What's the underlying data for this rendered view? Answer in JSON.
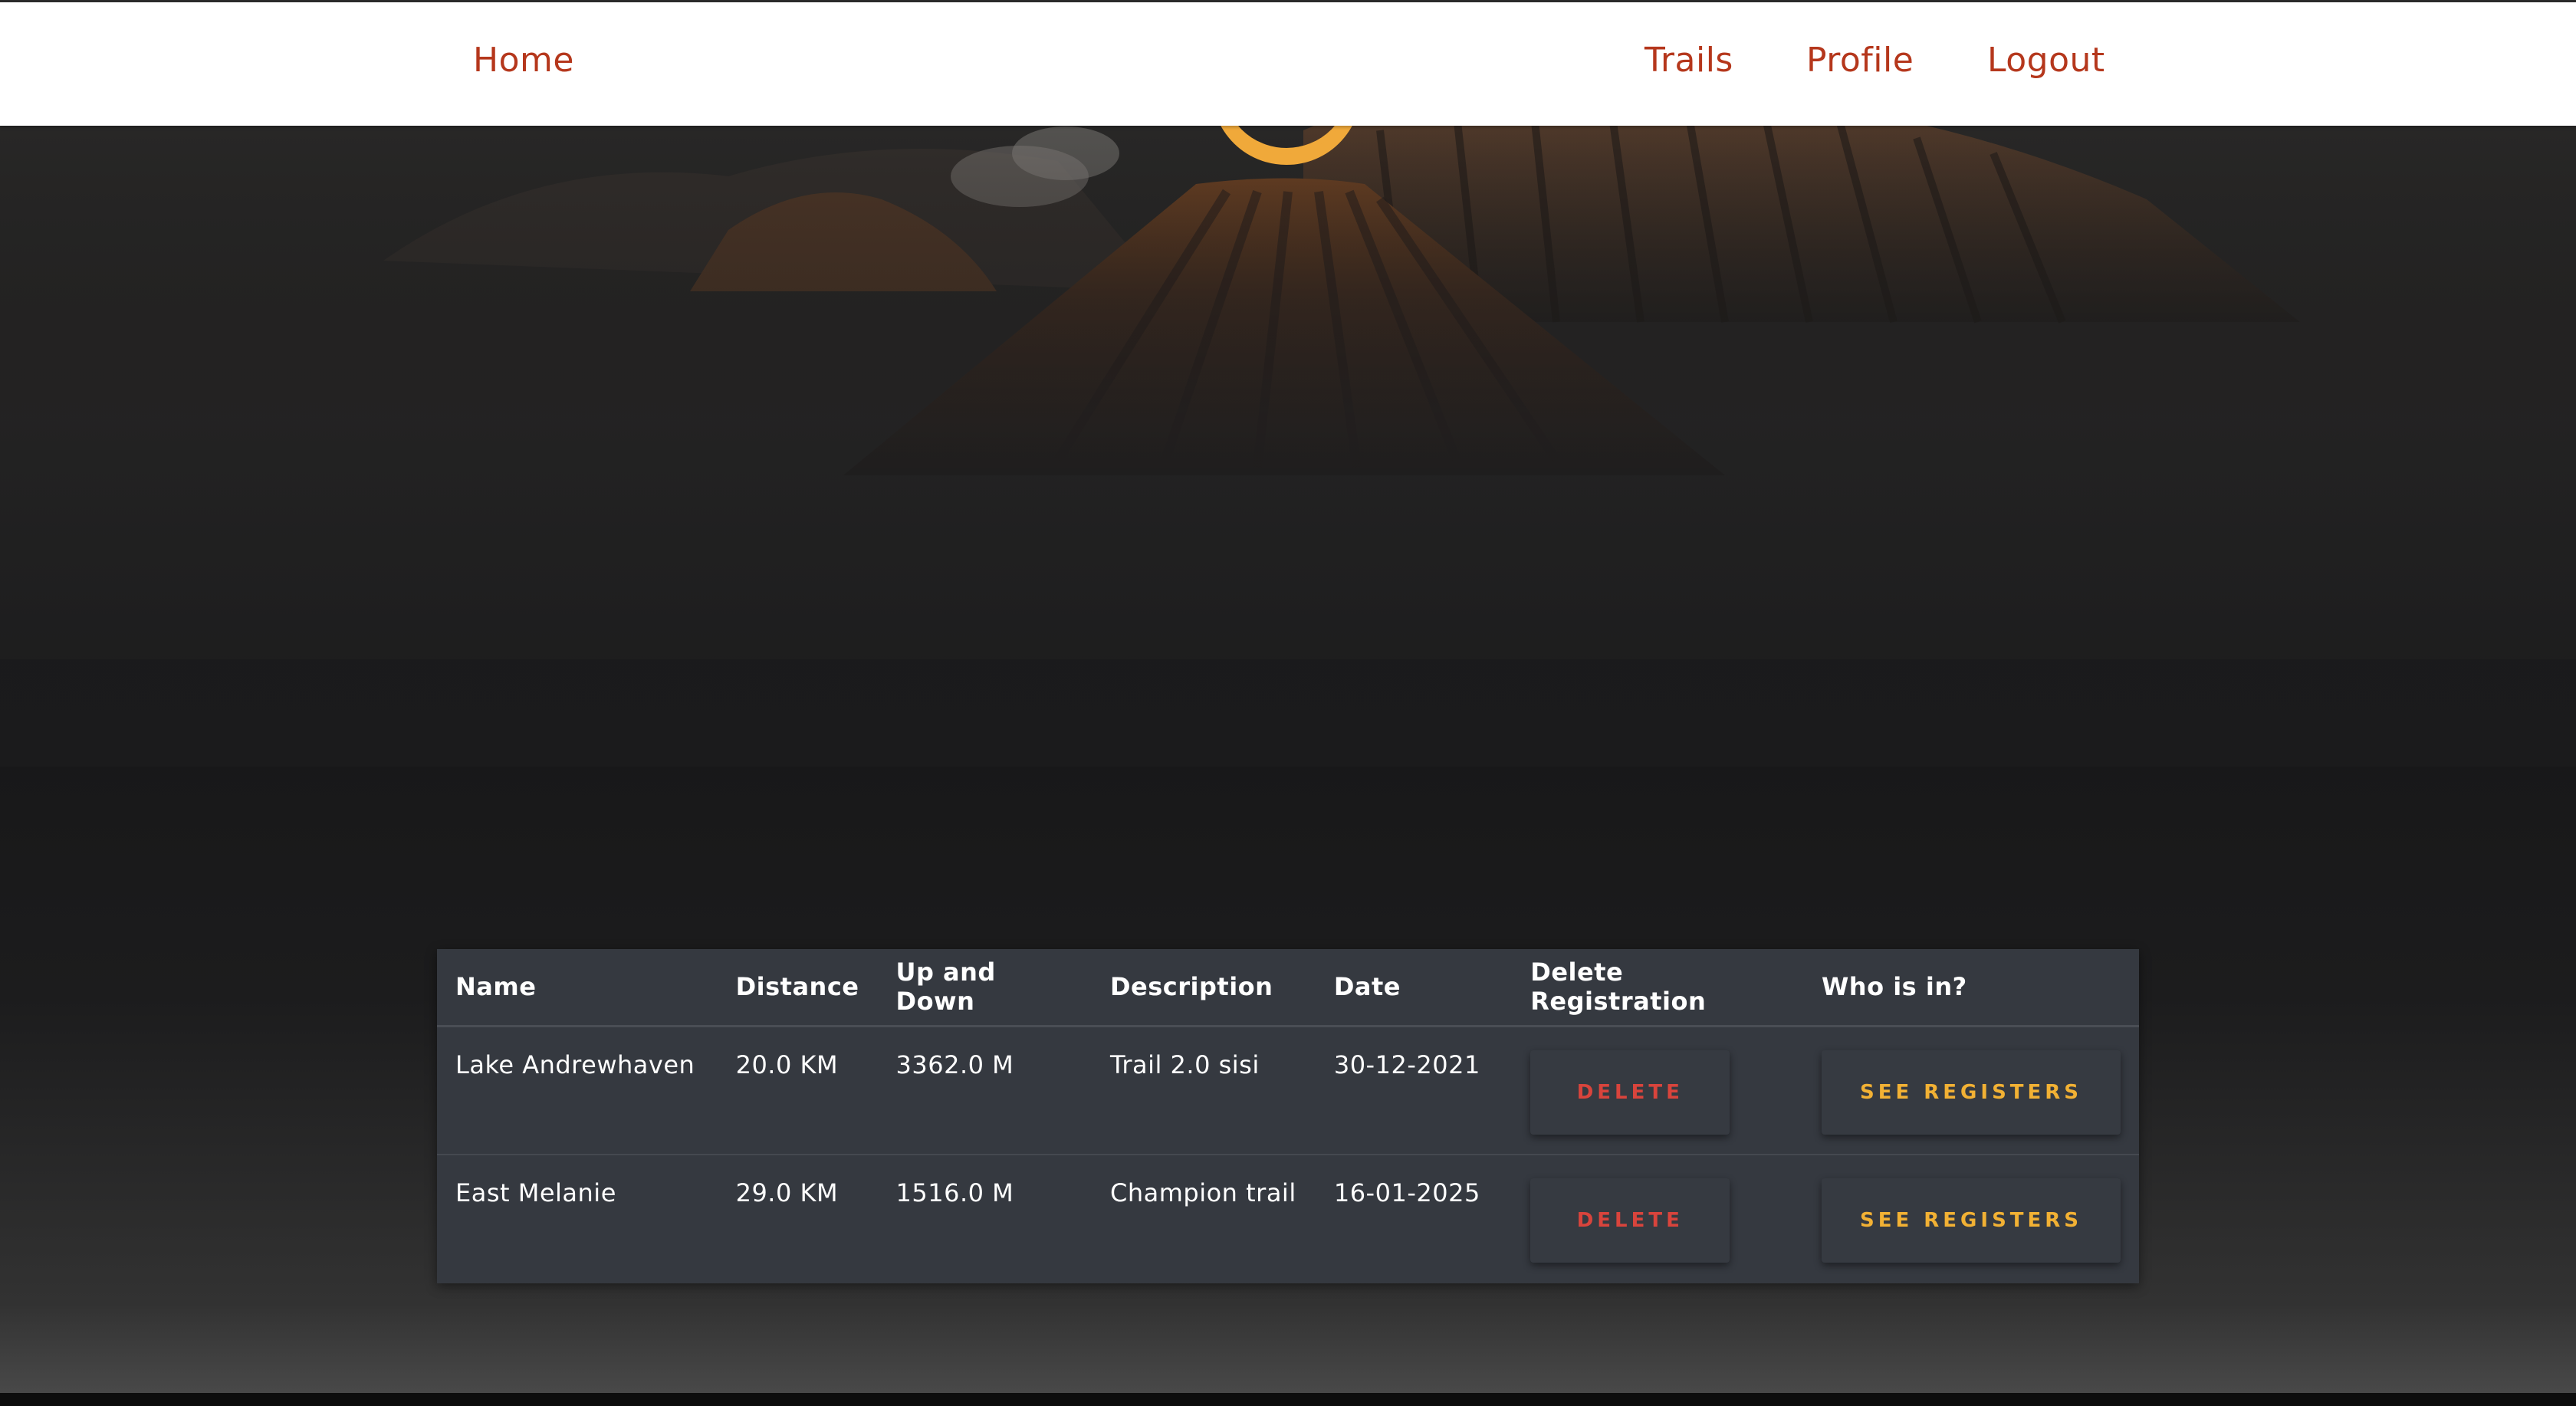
{
  "navbar": {
    "home": "Home",
    "links": [
      "Trails",
      "Profile",
      "Logout"
    ]
  },
  "table": {
    "headers": [
      "Name",
      "Distance",
      "Up and Down",
      "Description",
      "Date",
      "Delete Registration",
      "Who is in?"
    ],
    "rows": [
      {
        "name": "Lake Andrewhaven",
        "distance": "20.0 KM",
        "up_down": "3362.0 M",
        "description": "Trail 2.0 sisi",
        "date": "30-12-2021",
        "delete_label": "DELETE",
        "registers_label": "SEE REGISTERS"
      },
      {
        "name": "East Melanie",
        "distance": "29.0 KM",
        "up_down": "1516.0 M",
        "description": "Champion trail",
        "date": "16-01-2025",
        "delete_label": "DELETE",
        "registers_label": "SEE REGISTERS"
      }
    ]
  },
  "colors": {
    "nav_link": "#b5371c",
    "delete": "#d9443c",
    "registers": "#f2b134",
    "logo_ring": "#f0a93a",
    "table_bg": "#353940"
  },
  "icons": [
    "logo-ring-icon"
  ]
}
